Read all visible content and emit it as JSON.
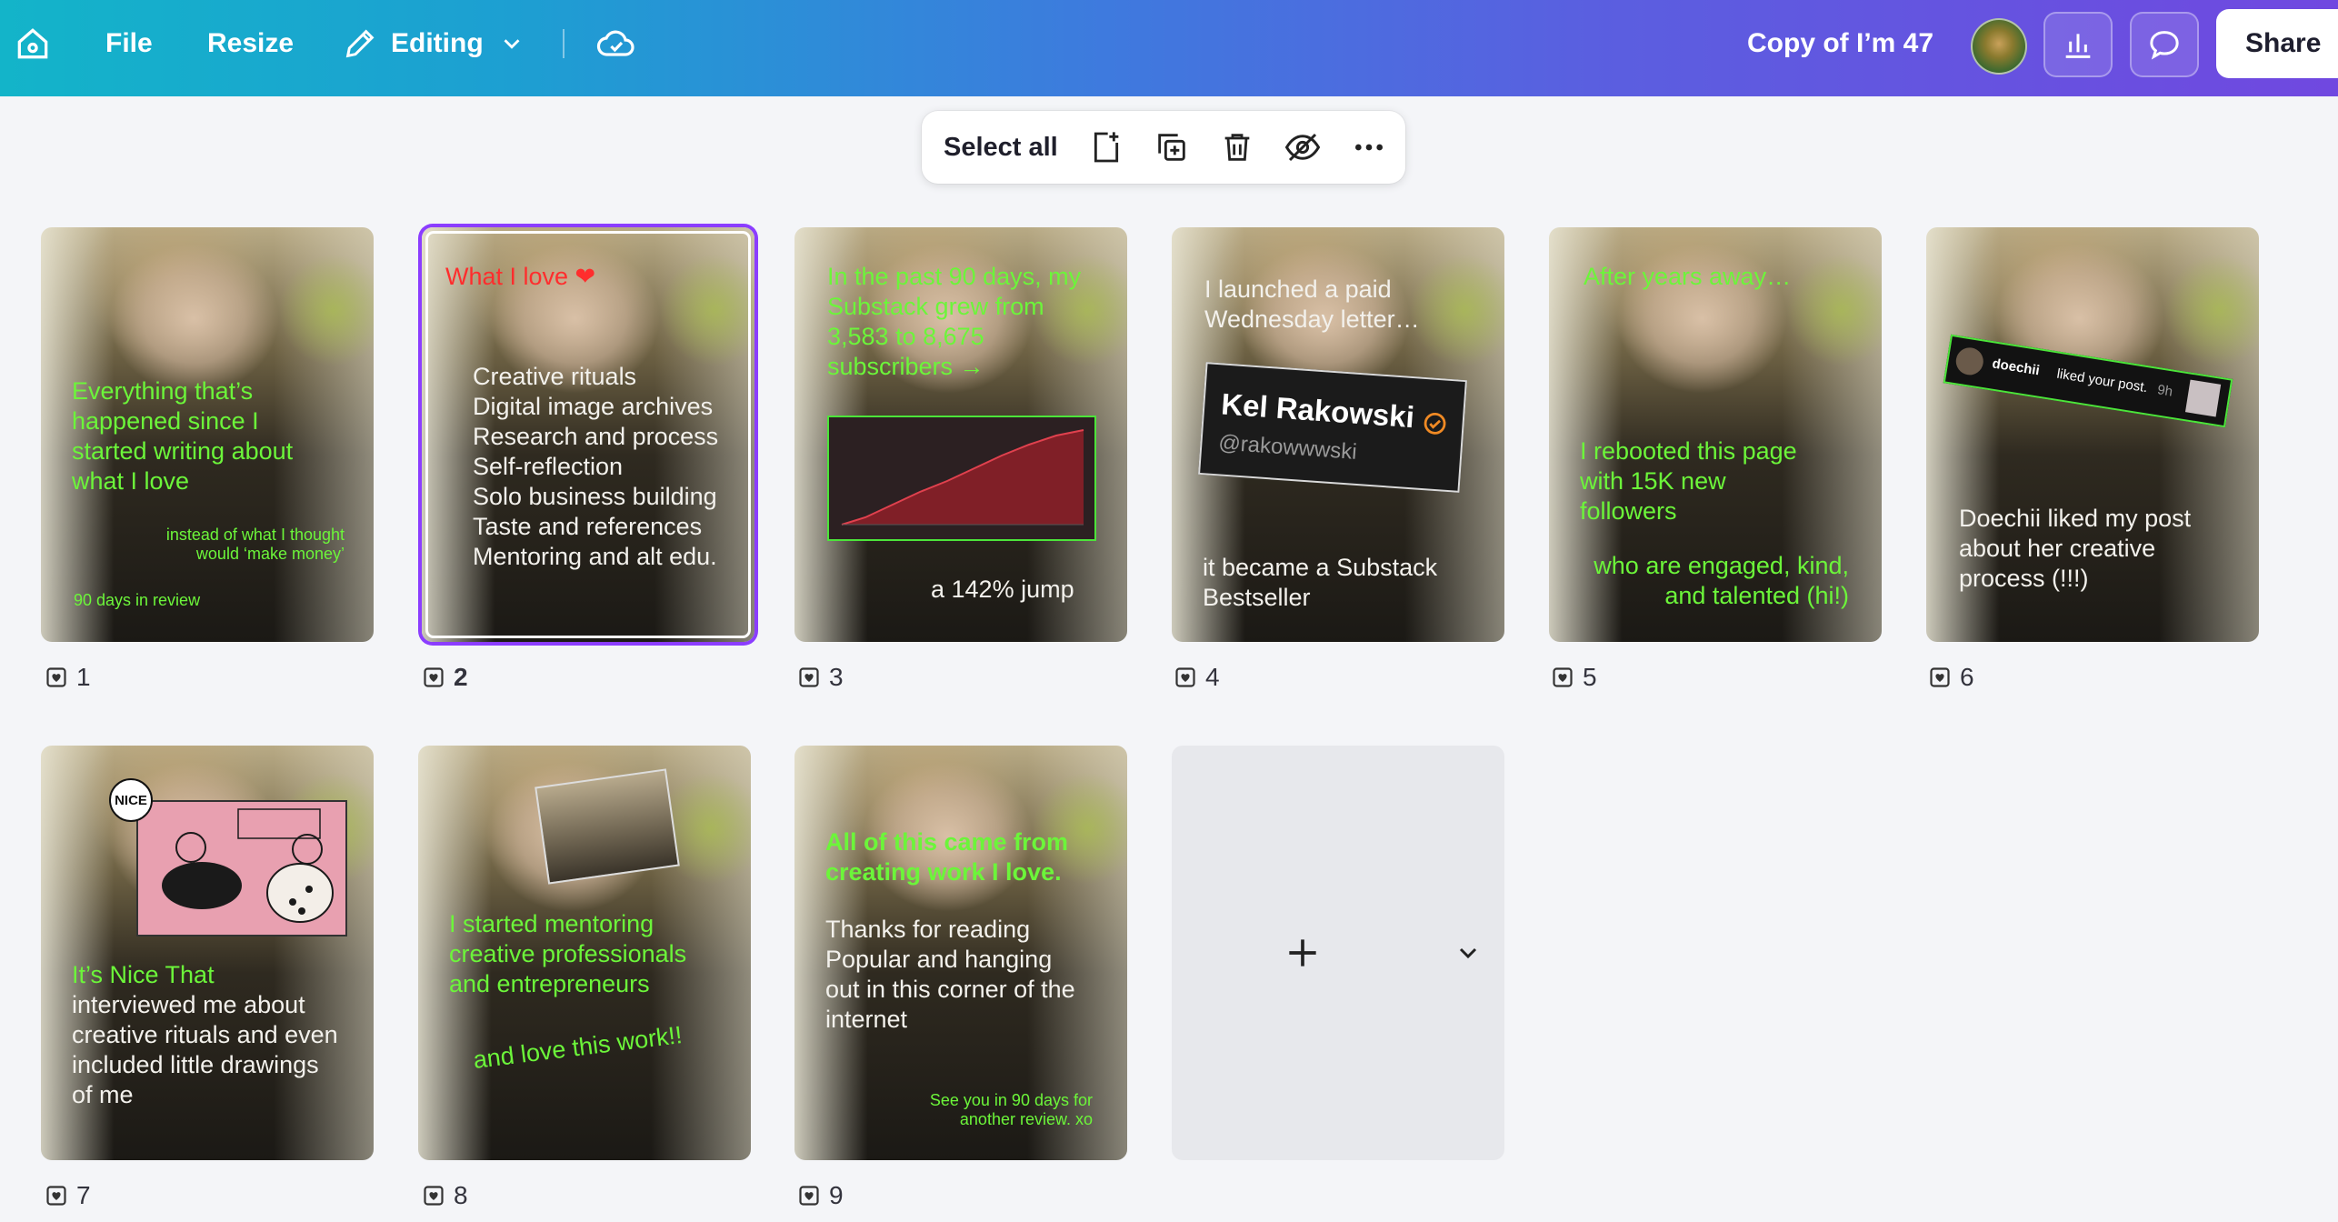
{
  "topbar": {
    "file_label": "File",
    "resize_label": "Resize",
    "editing_label": "Editing",
    "doc_title": "Copy of I’m 47",
    "share_label": "Share",
    "icons": [
      "home-icon",
      "pencil-icon",
      "chevron-down-icon",
      "cloud-check-icon",
      "insights-icon",
      "comment-icon"
    ]
  },
  "floating_toolbar": {
    "select_all_label": "Select all",
    "icons": [
      "add-page-icon",
      "duplicate-page-icon",
      "delete-icon",
      "hide-icon",
      "more-icon"
    ]
  },
  "pages": [
    {
      "number": "1",
      "texts": {
        "main": "Everything that’s happened since I started writing about what I love",
        "sub": "instead of what I thought would ‘make money’",
        "footer": "90 days in review"
      }
    },
    {
      "number": "2",
      "selected": true,
      "texts": {
        "title": "What I love ❤",
        "list": [
          "Creative rituals",
          "Digital image archives",
          "Research and process",
          "Self-reflection",
          "Solo business building",
          "Taste and references",
          "Mentoring and alt edu."
        ]
      }
    },
    {
      "number": "3",
      "texts": {
        "main": "In the past 90 days, my Substack grew from 3,583 to 8,675 subscribers →",
        "jump": "a 142% jump"
      }
    },
    {
      "number": "4",
      "texts": {
        "main": "I launched a paid Wednesday letter…",
        "name": "Kel Rakowski",
        "handle": "@rakowwwski",
        "bottom": "it became a Substack Bestseller"
      }
    },
    {
      "number": "5",
      "texts": {
        "top": "After years away…",
        "main": "I rebooted this page with 15K new followers",
        "sub": "who are engaged, kind, and talented (hi!)"
      }
    },
    {
      "number": "6",
      "texts": {
        "notif_user": "doechii",
        "notif_text": "liked your post.",
        "notif_time": "9h",
        "main": "Doechii liked my post about her creative process (!!!)"
      }
    },
    {
      "number": "7",
      "texts": {
        "badge": "NICE",
        "highlight": "It’s Nice That",
        "main": "interviewed me about creative rituals and even included little drawings of me"
      }
    },
    {
      "number": "8",
      "texts": {
        "main": "I started mentoring creative professionals and entrepreneurs",
        "sub": "and love this work!!"
      }
    },
    {
      "number": "9",
      "texts": {
        "main": "All of this came from creating work I love.",
        "body": "Thanks for reading Popular and hanging out in this corner of the internet",
        "footer": "See you in 90 days for another review. xo"
      }
    }
  ],
  "add_page": {
    "icons": [
      "plus-icon",
      "chevron-down-icon"
    ]
  },
  "colors": {
    "accent_purple": "#8b3dff",
    "text_green": "#6cf53a",
    "text_red": "#ff2d2d"
  }
}
